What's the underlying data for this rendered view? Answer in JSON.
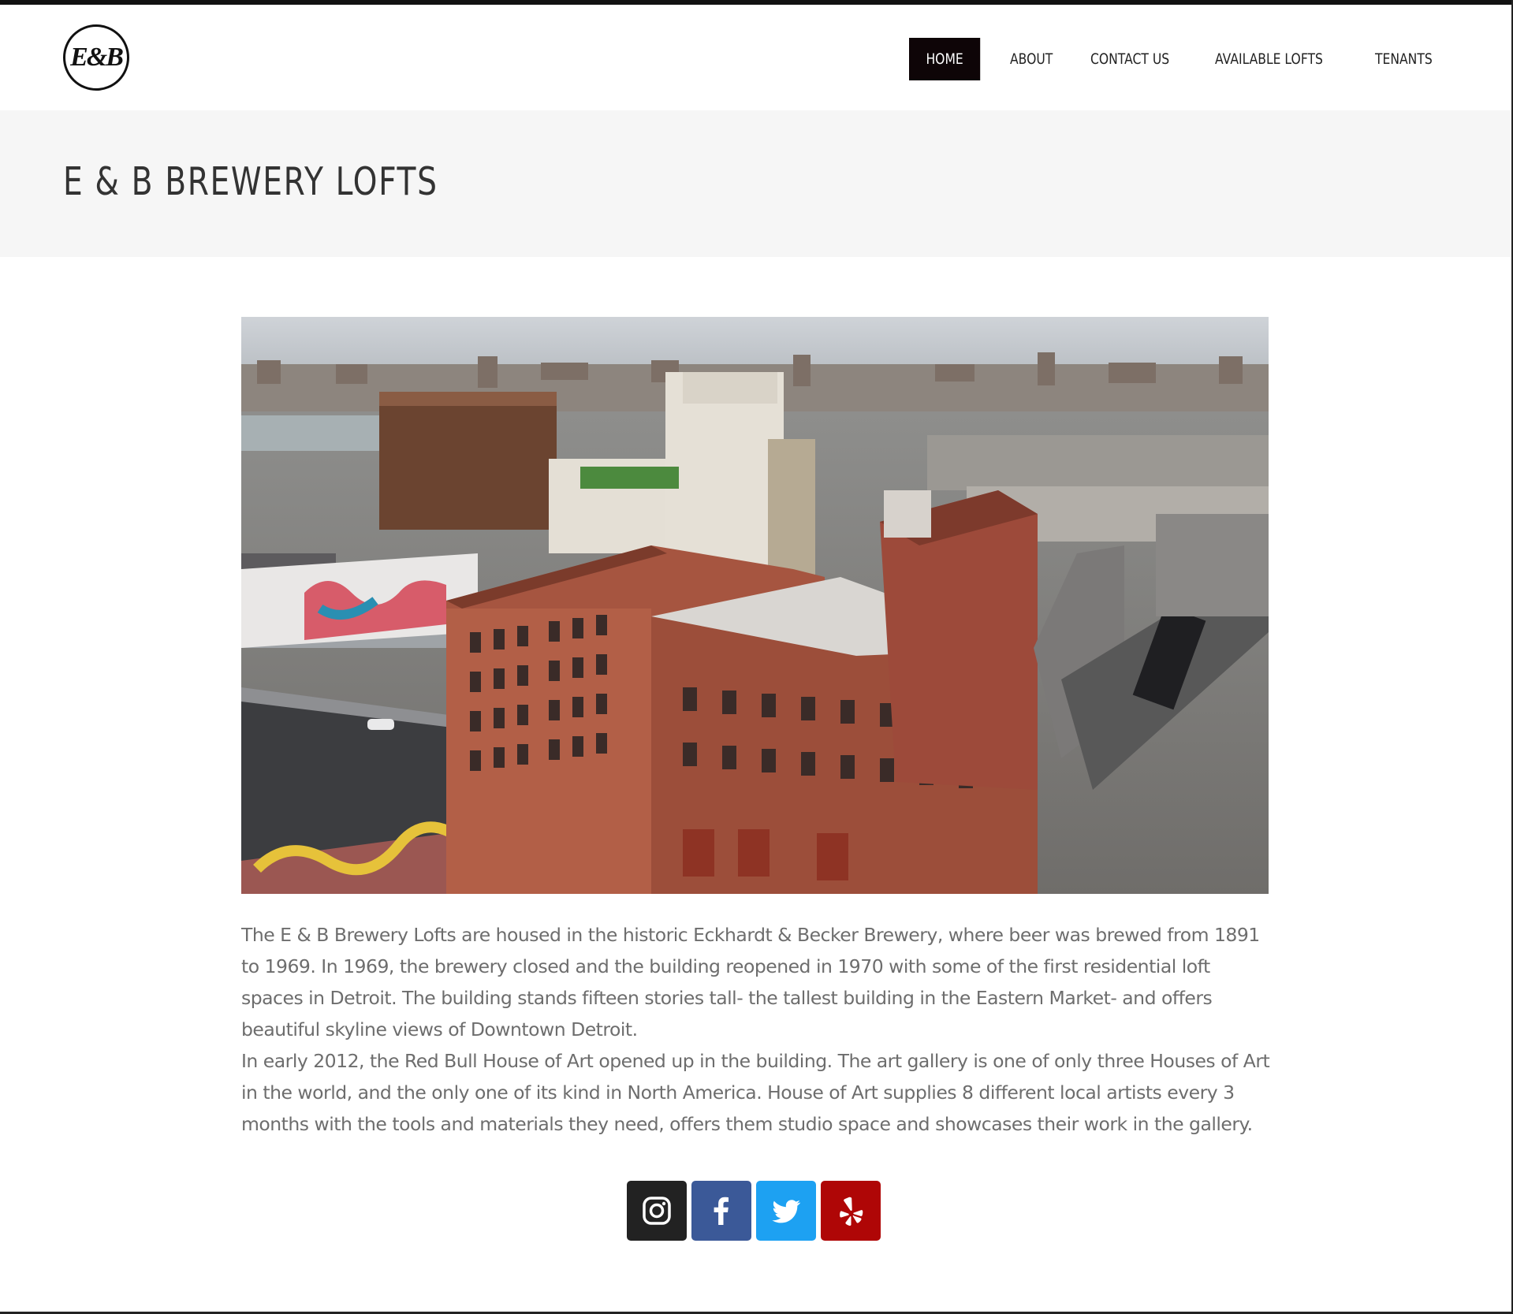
{
  "site": {
    "logo_text": "E&B"
  },
  "nav": {
    "items": [
      {
        "label": "HOME",
        "active": true
      },
      {
        "label": "ABOUT",
        "active": false
      },
      {
        "label": "CONTACT US",
        "active": false
      },
      {
        "label": "AVAILABLE LOFTS",
        "active": false
      },
      {
        "label": "TENANTS",
        "active": false
      }
    ]
  },
  "page": {
    "title": "E & B BREWERY LOFTS"
  },
  "hero_image": {
    "subject": "aerial photo of historic red-brick brewery building with downtown skyline"
  },
  "content": {
    "paragraph_1": "The E & B Brewery Lofts are housed in the historic Eckhardt & Becker Brewery, where beer was brewed from 1891 to 1969. In 1969, the brewery closed and the building reopened in 1970 with some of the first residential loft spaces in Detroit. The building stands fifteen stories tall- the tallest building in the Eastern Market- and offers beautiful skyline views of Downtown Detroit.",
    "paragraph_2": "In early 2012, the Red Bull House of Art opened up in the building. The art gallery is one of only three Houses of Art in the world, and the only one of its kind in North America. House of Art supplies 8 different local artists every 3 months with the tools and materials they need, offers them studio space and showcases their work in the gallery."
  },
  "social": [
    {
      "icon": "instagram-icon",
      "color": "#222222"
    },
    {
      "icon": "facebook-icon",
      "color": "#3b5998"
    },
    {
      "icon": "twitter-icon",
      "color": "#1da1f2"
    },
    {
      "icon": "yelp-icon",
      "color": "#af0606"
    }
  ],
  "colors": {
    "nav_active_bg": "#0e0507",
    "title_band_bg": "#f6f6f6",
    "body_text": "#6d6d6d"
  }
}
